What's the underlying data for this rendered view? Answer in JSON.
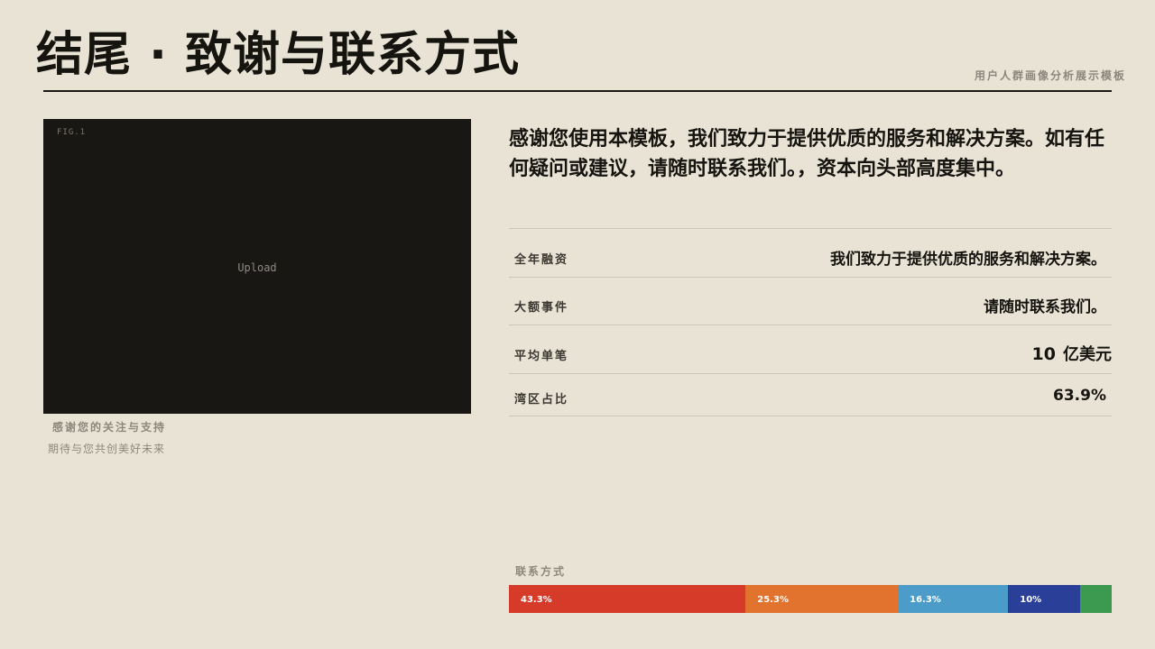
{
  "header": {
    "title": "结尾 · 致谢与联系方式",
    "template_name": "用户人群画像分析展示模板"
  },
  "photo": {
    "fig_label": "FIG.1",
    "placeholder": "Upload"
  },
  "caption": {
    "line1": "感谢您的关注与支持",
    "line2": "期待与您共创美好未来"
  },
  "lead_text": "感谢您使用本模板，我们致力于提供优质的服务和解决方案。如有任何疑问或建议，请随时联系我们。，资本向头部高度集中。",
  "stats": [
    {
      "label": "全年融资",
      "value": "我们致力于提供优质的服务和解决方案。"
    },
    {
      "label": "大额事件",
      "value": "请随时联系我们。"
    },
    {
      "label": "平均单笔",
      "number": "10",
      "unit": "亿美元"
    },
    {
      "label": "湾区占比",
      "value": "63.9%"
    }
  ],
  "contact": {
    "label": "联系方式",
    "segments": [
      {
        "label": "43.3%",
        "fraction": 0.393,
        "color": "#d63b2a"
      },
      {
        "label": "25.3%",
        "fraction": 0.253,
        "color": "#e2732e"
      },
      {
        "label": "16.3%",
        "fraction": 0.183,
        "color": "#4b9cc8"
      },
      {
        "label": "10%",
        "fraction": 0.12,
        "color": "#2a3f98"
      },
      {
        "label": "",
        "fraction": 0.052,
        "color": "#3b9a4f"
      }
    ]
  }
}
